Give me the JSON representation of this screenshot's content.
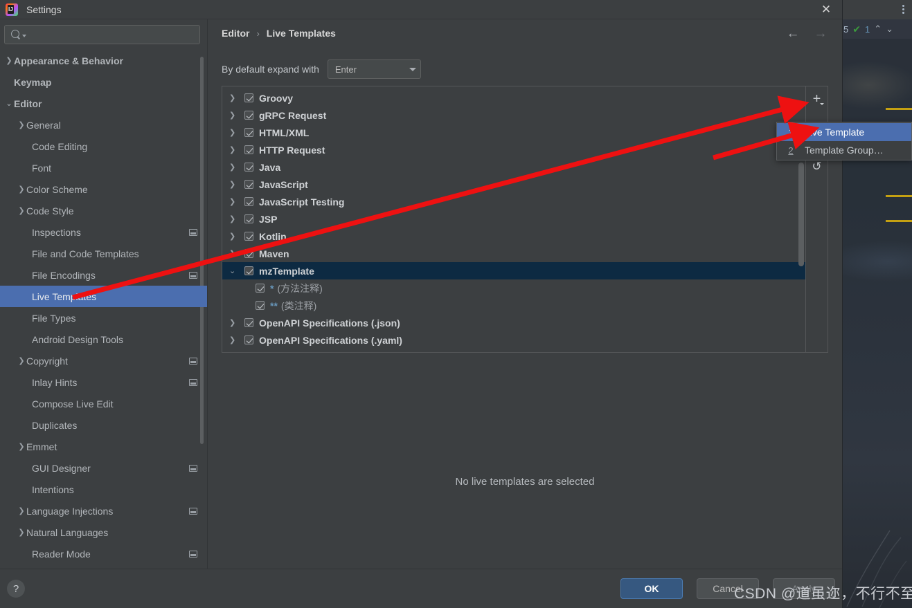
{
  "window": {
    "title": "Settings",
    "app_icon": "intellij-idea-icon",
    "close_label": "✕"
  },
  "search": {
    "value": "",
    "placeholder": ""
  },
  "sidebar": {
    "items": [
      {
        "label": "Appearance & Behavior",
        "level": 0,
        "arrow": "collapsed",
        "selected": false,
        "tail_icon": false
      },
      {
        "label": "Keymap",
        "level": 0,
        "arrow": "none",
        "selected": false,
        "tail_icon": false
      },
      {
        "label": "Editor",
        "level": 0,
        "arrow": "expanded",
        "selected": false,
        "tail_icon": false
      },
      {
        "label": "General",
        "level": 1,
        "arrow": "collapsed",
        "selected": false,
        "tail_icon": false
      },
      {
        "label": "Code Editing",
        "level": 1,
        "arrow": "none",
        "selected": false,
        "tail_icon": false
      },
      {
        "label": "Font",
        "level": 1,
        "arrow": "none",
        "selected": false,
        "tail_icon": false
      },
      {
        "label": "Color Scheme",
        "level": 1,
        "arrow": "collapsed",
        "selected": false,
        "tail_icon": false
      },
      {
        "label": "Code Style",
        "level": 1,
        "arrow": "collapsed",
        "selected": false,
        "tail_icon": false
      },
      {
        "label": "Inspections",
        "level": 1,
        "arrow": "none",
        "selected": false,
        "tail_icon": true
      },
      {
        "label": "File and Code Templates",
        "level": 1,
        "arrow": "none",
        "selected": false,
        "tail_icon": false
      },
      {
        "label": "File Encodings",
        "level": 1,
        "arrow": "none",
        "selected": false,
        "tail_icon": true
      },
      {
        "label": "Live Templates",
        "level": 1,
        "arrow": "none",
        "selected": true,
        "tail_icon": false
      },
      {
        "label": "File Types",
        "level": 1,
        "arrow": "none",
        "selected": false,
        "tail_icon": false
      },
      {
        "label": "Android Design Tools",
        "level": 1,
        "arrow": "none",
        "selected": false,
        "tail_icon": false
      },
      {
        "label": "Copyright",
        "level": 1,
        "arrow": "collapsed",
        "selected": false,
        "tail_icon": true
      },
      {
        "label": "Inlay Hints",
        "level": 1,
        "arrow": "none",
        "selected": false,
        "tail_icon": true
      },
      {
        "label": "Compose Live Edit",
        "level": 1,
        "arrow": "none",
        "selected": false,
        "tail_icon": false
      },
      {
        "label": "Duplicates",
        "level": 1,
        "arrow": "none",
        "selected": false,
        "tail_icon": false
      },
      {
        "label": "Emmet",
        "level": 1,
        "arrow": "collapsed",
        "selected": false,
        "tail_icon": false
      },
      {
        "label": "GUI Designer",
        "level": 1,
        "arrow": "none",
        "selected": false,
        "tail_icon": true
      },
      {
        "label": "Intentions",
        "level": 1,
        "arrow": "none",
        "selected": false,
        "tail_icon": false
      },
      {
        "label": "Language Injections",
        "level": 1,
        "arrow": "collapsed",
        "selected": false,
        "tail_icon": true
      },
      {
        "label": "Natural Languages",
        "level": 1,
        "arrow": "collapsed",
        "selected": false,
        "tail_icon": false
      },
      {
        "label": "Reader Mode",
        "level": 1,
        "arrow": "none",
        "selected": false,
        "tail_icon": true
      }
    ]
  },
  "content": {
    "breadcrumb": {
      "root": "Editor",
      "separator": "›",
      "leaf": "Live Templates"
    },
    "expand_with": {
      "label": "By default expand with",
      "value": "Enter"
    },
    "empty_message": "No live templates are selected",
    "templates": [
      {
        "name": "Groovy",
        "checked": true,
        "type": "group",
        "arrow": "collapsed",
        "selected": false
      },
      {
        "name": "gRPC Request",
        "checked": true,
        "type": "group",
        "arrow": "collapsed",
        "selected": false
      },
      {
        "name": "HTML/XML",
        "checked": true,
        "type": "group",
        "arrow": "collapsed",
        "selected": false
      },
      {
        "name": "HTTP Request",
        "checked": true,
        "type": "group",
        "arrow": "collapsed",
        "selected": false
      },
      {
        "name": "Java",
        "checked": true,
        "type": "group",
        "arrow": "collapsed",
        "selected": false
      },
      {
        "name": "JavaScript",
        "checked": true,
        "type": "group",
        "arrow": "collapsed",
        "selected": false
      },
      {
        "name": "JavaScript Testing",
        "checked": true,
        "type": "group",
        "arrow": "collapsed",
        "selected": false
      },
      {
        "name": "JSP",
        "checked": true,
        "type": "group",
        "arrow": "collapsed",
        "selected": false
      },
      {
        "name": "Kotlin",
        "checked": true,
        "type": "group",
        "arrow": "collapsed",
        "selected": false
      },
      {
        "name": "Maven",
        "checked": true,
        "type": "group",
        "arrow": "collapsed",
        "selected": false
      },
      {
        "name": "mzTemplate",
        "checked": true,
        "type": "group",
        "arrow": "expanded",
        "selected": true
      },
      {
        "abbrev": "*",
        "description": "(方法注释)",
        "checked": true,
        "type": "child",
        "selected": false
      },
      {
        "abbrev": "**",
        "description": "(类注释)",
        "checked": true,
        "type": "child",
        "selected": false
      },
      {
        "name": "OpenAPI Specifications (.json)",
        "checked": true,
        "type": "group",
        "arrow": "collapsed",
        "selected": false
      },
      {
        "name": "OpenAPI Specifications (.yaml)",
        "checked": true,
        "type": "group",
        "arrow": "collapsed",
        "selected": false
      }
    ],
    "toolbar": {
      "add_label": "+",
      "add_icon": "plus-icon",
      "revert_icon": "undo-icon"
    },
    "nav": {
      "back_icon": "arrow-left-icon",
      "forward_icon": "arrow-right-icon"
    }
  },
  "popup_menu": {
    "items": [
      {
        "number": "1",
        "label": "Live Template",
        "active": true
      },
      {
        "number": "2",
        "label": "Template Group…",
        "active": false
      }
    ]
  },
  "footer": {
    "help_label": "?",
    "ok_label": "OK",
    "cancel_label": "Cancel",
    "apply_label": "Apply"
  },
  "ide_background": {
    "status_count": "5",
    "inspection_count": "1",
    "check_icon": "green-check-icon",
    "up_icon": "chevron-up-icon",
    "down_icon": "chevron-down-icon",
    "kebab_icon": "more-vertical-icon"
  },
  "watermark": {
    "text": "CSDN @道虽迩，不行不至"
  },
  "colors": {
    "accent_selection": "#4b6eaf",
    "tree_selection_inactive": "#0d2a42",
    "dialog_bg": "#3c3f41",
    "ok_button": "#365880",
    "annotation_arrow": "#ee1111",
    "marker_gold": "#c4a012"
  }
}
